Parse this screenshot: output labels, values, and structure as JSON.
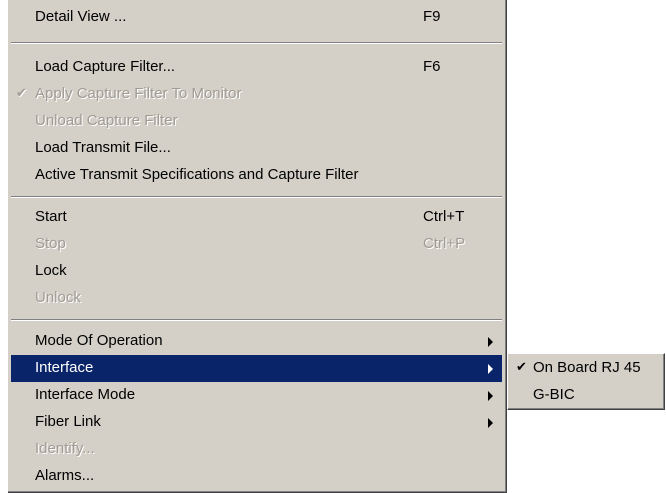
{
  "menu": {
    "items": [
      {
        "label": "Detail View ...",
        "shortcut": "F9"
      },
      {
        "label": "Load Capture Filter...",
        "shortcut": "F6"
      },
      {
        "label": "Apply Capture Filter To Monitor",
        "check": "✔"
      },
      {
        "label": "Unload Capture Filter"
      },
      {
        "label": "Load Transmit File..."
      },
      {
        "label": "Active Transmit Specifications and Capture Filter"
      },
      {
        "label": "Start",
        "shortcut": "Ctrl+T"
      },
      {
        "label": "Stop",
        "shortcut": "Ctrl+P"
      },
      {
        "label": "Lock"
      },
      {
        "label": "Unlock"
      },
      {
        "label": "Mode Of Operation"
      },
      {
        "label": "Interface"
      },
      {
        "label": "Interface Mode"
      },
      {
        "label": "Fiber Link"
      },
      {
        "label": "Identify..."
      },
      {
        "label": "Alarms..."
      }
    ]
  },
  "submenu": {
    "items": [
      {
        "label": "On Board RJ 45",
        "check": "✔"
      },
      {
        "label": "G-BIC"
      }
    ]
  },
  "colors": {
    "menu_bg": "#d4d0c8",
    "highlight_bg": "#0a246a",
    "highlight_text": "#ffffff",
    "disabled_text": "#a09c94"
  }
}
